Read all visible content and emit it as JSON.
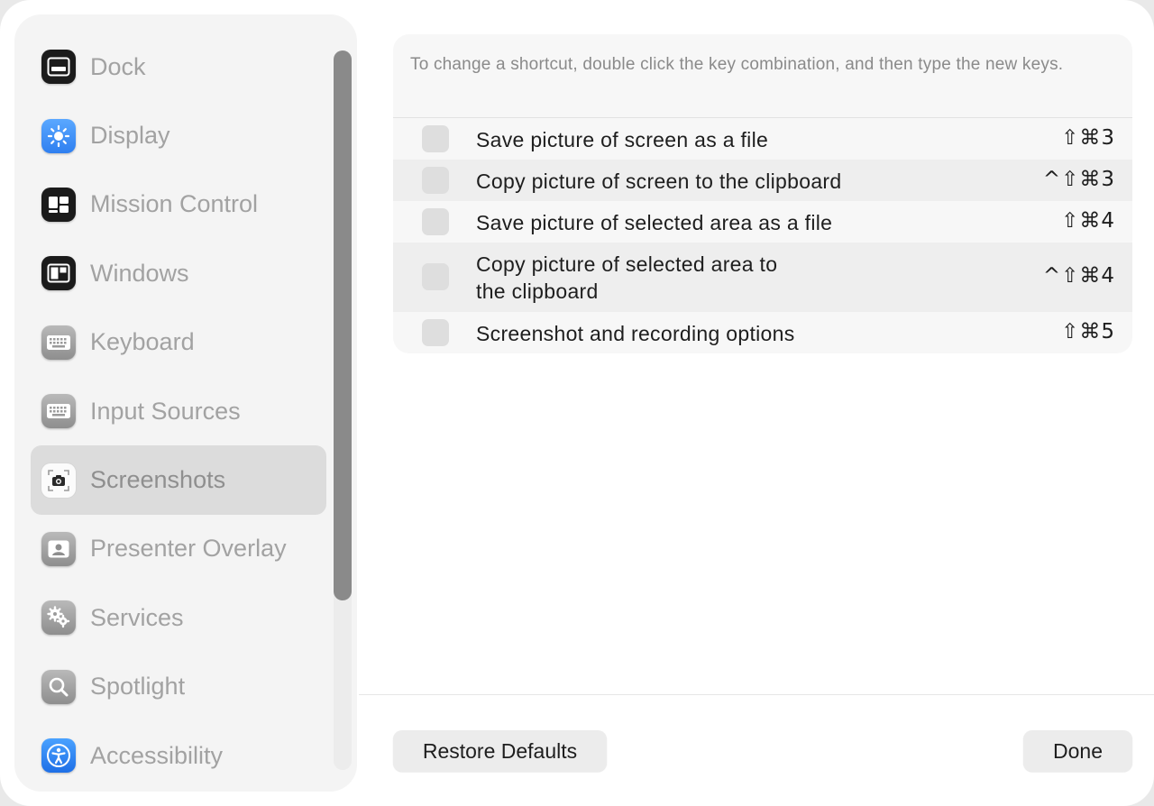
{
  "sidebar": {
    "items": [
      {
        "label": "Dock",
        "icon": "dock-icon"
      },
      {
        "label": "Display",
        "icon": "display-brightness-icon"
      },
      {
        "label": "Mission Control",
        "icon": "mission-control-icon"
      },
      {
        "label": "Windows",
        "icon": "windows-icon"
      },
      {
        "label": "Keyboard",
        "icon": "keyboard-icon"
      },
      {
        "label": "Input Sources",
        "icon": "input-sources-icon"
      },
      {
        "label": "Screenshots",
        "icon": "screenshot-camera-icon",
        "selected": true
      },
      {
        "label": "Presenter Overlay",
        "icon": "presenter-overlay-icon"
      },
      {
        "label": "Services",
        "icon": "gears-icon"
      },
      {
        "label": "Spotlight",
        "icon": "magnifier-icon"
      },
      {
        "label": "Accessibility",
        "icon": "accessibility-icon"
      }
    ]
  },
  "panel": {
    "hint": "To change a shortcut, double click the key combination, and then type the new keys.",
    "rows": [
      {
        "label": "Save picture of screen as a file",
        "shortcut": "⇧⌘3"
      },
      {
        "label": "Copy picture of screen to the clipboard",
        "shortcut": "^⇧⌘3"
      },
      {
        "label": "Save picture of selected area as a file",
        "shortcut": "⇧⌘4"
      },
      {
        "label_line1": "Copy picture of selected area to",
        "label_line2": "the clipboard",
        "shortcut": "^⇧⌘4"
      },
      {
        "label": "Screenshot and recording options",
        "shortcut": "⇧⌘5"
      }
    ]
  },
  "footer": {
    "restore_label": "Restore Defaults",
    "done_label": "Done"
  }
}
